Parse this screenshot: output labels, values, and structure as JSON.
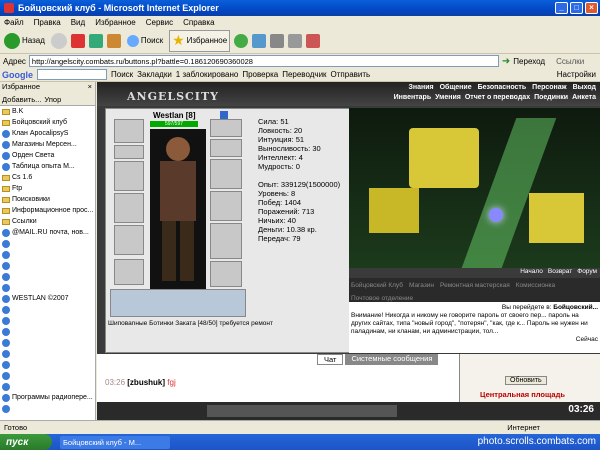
{
  "window": {
    "title": "Бойцовский клуб - Microsoft Internet Explorer"
  },
  "menu": [
    "Файл",
    "Правка",
    "Вид",
    "Избранное",
    "Сервис",
    "Справка"
  ],
  "toolbar": {
    "back": "Назад",
    "search": "Поиск",
    "favorites": "Избранное"
  },
  "address": {
    "label": "Адрес",
    "url": "http://angelscity.combats.ru/buttons.pl?battle=0.186120690360028",
    "go": "Переход",
    "links": "Ссылки"
  },
  "google": {
    "label": "Google",
    "search": "Поиск",
    "bookmarks": "Закладки",
    "blocked": "1 заблокировано",
    "check": "Проверка",
    "translate": "Переводчик",
    "send": "Отправить",
    "settings": "Настройки"
  },
  "sidebar": {
    "title": "Избранное",
    "add": "Добавить...",
    "org": "Упор",
    "items": [
      {
        "icon": "folder",
        "label": "B.K"
      },
      {
        "icon": "folder",
        "label": "Бойцовский клуб"
      },
      {
        "icon": "ie",
        "label": "Клан ApocalipsyS"
      },
      {
        "icon": "ie",
        "label": "Магазины Мерсен..."
      },
      {
        "icon": "ie",
        "label": "Орден Света"
      },
      {
        "icon": "ie",
        "label": "Таблица опыта М..."
      },
      {
        "icon": "folder",
        "label": "Cs 1.6"
      },
      {
        "icon": "folder",
        "label": "Ftp"
      },
      {
        "icon": "folder",
        "label": "Поисковики"
      },
      {
        "icon": "folder",
        "label": "Информационное прос..."
      },
      {
        "icon": "folder",
        "label": "Ссылки"
      },
      {
        "icon": "ie",
        "label": "@MAIL.RU почта, нов..."
      },
      {
        "icon": "ie",
        "label": ""
      },
      {
        "icon": "ie",
        "label": ""
      },
      {
        "icon": "ie",
        "label": ""
      },
      {
        "icon": "ie",
        "label": ""
      },
      {
        "icon": "ie",
        "label": ""
      },
      {
        "icon": "ie",
        "label": "WESTLAN ©2007"
      },
      {
        "icon": "ie",
        "label": ""
      },
      {
        "icon": "ie",
        "label": ""
      },
      {
        "icon": "ie",
        "label": ""
      },
      {
        "icon": "ie",
        "label": ""
      },
      {
        "icon": "ie",
        "label": ""
      },
      {
        "icon": "ie",
        "label": ""
      },
      {
        "icon": "ie",
        "label": ""
      },
      {
        "icon": "ie",
        "label": ""
      },
      {
        "icon": "ie",
        "label": "Программы радиопере..."
      },
      {
        "icon": "ie",
        "label": ""
      }
    ]
  },
  "game": {
    "logo": "ANGELSCITY",
    "nav1": [
      "Знания",
      "Общение",
      "Безопасность",
      "Персонаж",
      "Выход"
    ],
    "nav2": [
      "Инвентарь",
      "Умения",
      "Отчет о переводах",
      "Поединки",
      "Анкета"
    ],
    "character": {
      "name": "Westlan [8]",
      "hp": "597/597"
    },
    "stats": [
      "Сила: 51",
      "Ловкость: 20",
      "Интуиция: 51",
      "Выносливость: 30",
      "Интеллект: 4",
      "Мудрость: 0",
      "",
      "Опыт: 339129(1500000)",
      "Уровень: 8",
      "Побед: 1404",
      "Поражений: 713",
      "Ничьих: 40",
      "Деньги: 10.38 кр.",
      "Передач: 79"
    ],
    "item_note": "Шиповanные Ботинки Заката [48/50] требуется ремонт",
    "city": {
      "links": [
        "Начало",
        "Возврат",
        "Форум"
      ],
      "locs": [
        "Бойцовский Клуб",
        "Магазин",
        "Ремонтная мастерская",
        "Комиссионка",
        "Почтовое отделение"
      ],
      "move": "Вы перейдете в:",
      "dest": "Бойцовский...",
      "warning": "Внимание! Никогда и никому не говорите пароль от своего пер... пароль на других сайтах, типа \"новый город\", \"потерян\", \"как, где к... Пароль не нужен ни паладинам, ни кланам, ни администрации, тол...",
      "now": "Сейчас"
    },
    "chat": {
      "time": "03:26",
      "user": "[zbushuk]",
      "msg": "fgj",
      "tab1": "Чат",
      "tab2": "Системные сообщения",
      "refresh": "Обновить",
      "right": "Центральная площадь"
    },
    "clock": "03:26"
  },
  "status": {
    "left": "Готово",
    "right": "Интернет"
  },
  "taskbar": {
    "start": "пуск",
    "task": "Бойцовский клуб - M...",
    "watermark": "photo.scrolls.combats.com"
  }
}
